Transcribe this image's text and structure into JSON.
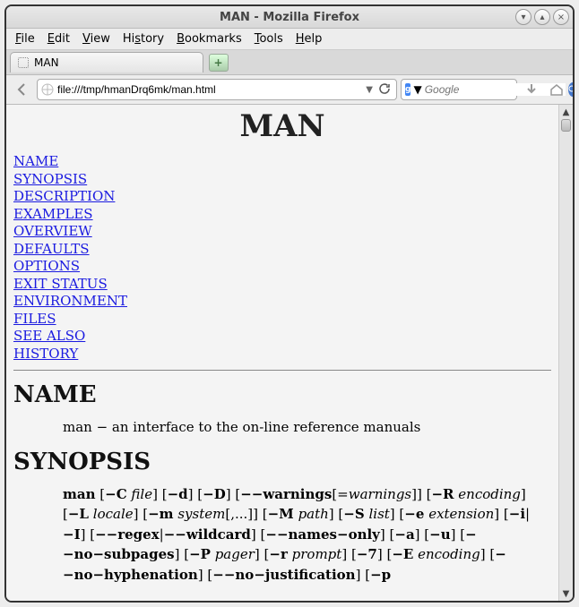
{
  "window": {
    "title": "MAN - Mozilla Firefox"
  },
  "menu": {
    "file": "File",
    "edit": "Edit",
    "view": "View",
    "history": "History",
    "bookmarks": "Bookmarks",
    "tools": "Tools",
    "help": "Help"
  },
  "tab": {
    "label": "MAN"
  },
  "url": {
    "value": "file:///tmp/hmanDrq6mk/man.html"
  },
  "search": {
    "placeholder": "Google"
  },
  "doc": {
    "title": "MAN",
    "toc": {
      "name": "NAME",
      "synopsis": "SYNOPSIS",
      "description": "DESCRIPTION",
      "examples": "EXAMPLES",
      "overview": "OVERVIEW",
      "defaults": "DEFAULTS",
      "options": "OPTIONS",
      "exit": "EXIT STATUS",
      "env": "ENVIRONMENT",
      "files": "FILES",
      "seealso": "SEE ALSO",
      "history": "HISTORY"
    },
    "sec_name": "NAME",
    "name_text": "man − an interface to the on-line reference manuals",
    "sec_synopsis": "SYNOPSIS"
  },
  "chart_data": null
}
